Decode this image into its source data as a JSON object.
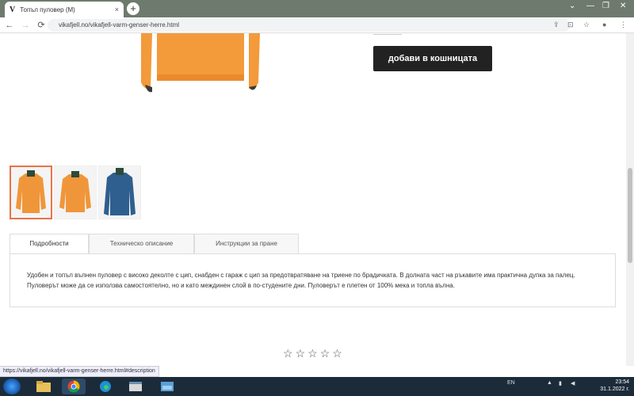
{
  "browser": {
    "tab_title": "Топъл пуловер (M)",
    "tab_favicon": "V",
    "close_glyph": "×",
    "new_tab_glyph": "+",
    "url": "vikafjell.no/vikafjell-varm-genser-herre.html",
    "back_glyph": "←",
    "forward_glyph": "→",
    "reload_glyph": "⟳"
  },
  "product": {
    "add_to_cart_label": "добави в кошницата",
    "main_image_color": "#f39a3b"
  },
  "thumbnails": [
    {
      "name": "orange-sweater-front",
      "color": "#f0963a",
      "active": true
    },
    {
      "name": "orange-sweater-back",
      "color": "#f0963a",
      "active": false
    },
    {
      "name": "blue-sweater",
      "color": "#2f5f8e",
      "active": false
    }
  ],
  "tabs": [
    {
      "label": "Подробности",
      "active": true
    },
    {
      "label": "Техническо описание",
      "active": false
    },
    {
      "label": "Инструкции за пране",
      "active": false
    }
  ],
  "description": "Удобен и топъл вълнен пуловер с високо деколте с цип, снабден с гараж с цип за предотвратяване на триене по брадичката. В долната част на ръкавите има практична дупка за палец. Пуловерът може да се използва самостоятелно, но и като междинен слой в по-студените дни. Пуловерът е плетен от 100% мека и топла вълна.",
  "rating": {
    "stars": 5,
    "filled": 0,
    "glyph": "☆"
  },
  "status_url": "https://vikafjell.no/vikafjell-varm-genser-herre.html#description",
  "taskbar": {
    "language": "EN",
    "time": "23:54",
    "date": "31.1.2022 г."
  },
  "colors": {
    "accent_border": "#e8734a",
    "button_bg": "#222222"
  }
}
